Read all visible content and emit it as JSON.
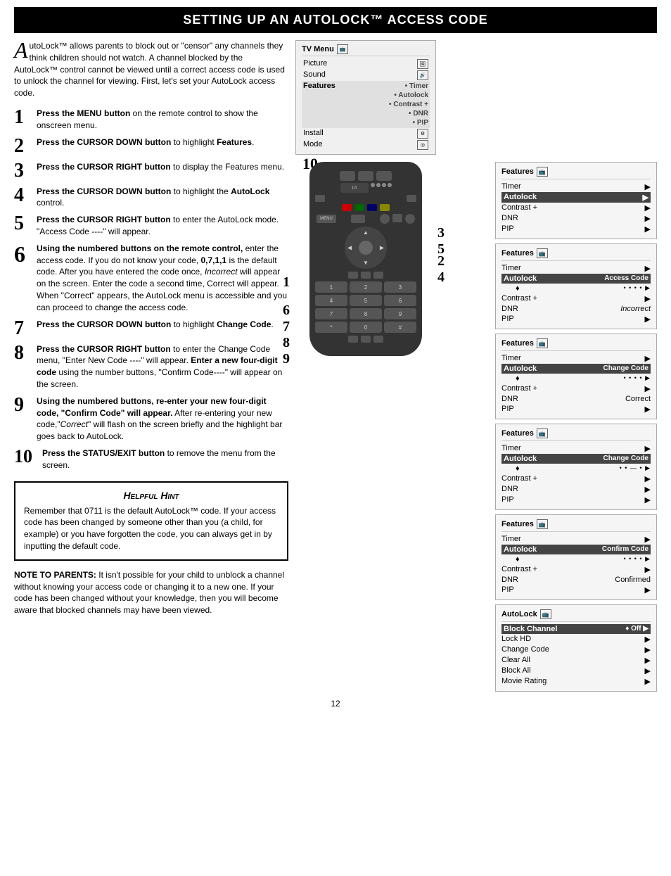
{
  "header": {
    "title": "Setting Up an AutoLock™ Access Code"
  },
  "intro": {
    "drop_cap": "A",
    "text": "utoLock™ allows parents to block out or \"censor\" any channels they think children should not watch. A channel blocked by the AutoLock™ control cannot be viewed until a correct access code is used to unlock the channel for viewing. First, let's set your AutoLock access code."
  },
  "steps": [
    {
      "num": "1",
      "text": "Press the MENU button on the remote control to show the onscreen menu."
    },
    {
      "num": "2",
      "text": "Press the CURSOR DOWN button to highlight Features."
    },
    {
      "num": "3",
      "text": "Press the CURSOR RIGHT button to display the Features menu."
    },
    {
      "num": "4",
      "text": "Press the CURSOR DOWN button to highlight the AutoLock control."
    },
    {
      "num": "5",
      "text": "Press the CURSOR RIGHT button to enter the AutoLock mode. \"Access Code ----\" will appear."
    },
    {
      "num": "6",
      "text": "Using the numbered buttons on the remote control, enter the access code. If you do not know your code, 0,7,1,1 is the default code. After you have entered the code once, Incorrect will appear on the screen. Enter the code a second time, Correct will appear. When \"Correct\" appears, the AutoLock menu is accessible and you can proceed to change the access code."
    },
    {
      "num": "7",
      "text": "Press the CURSOR DOWN button to highlight Change Code."
    },
    {
      "num": "8",
      "text": "Press the CURSOR RIGHT button to enter the Change Code menu, \"Enter New Code ----\" will appear. Enter a new four-digit code using the number buttons, \"Confirm Code----\" will appear on the screen."
    },
    {
      "num": "9",
      "text": "Using the numbered buttons, re-enter your new four-digit code, \"Confirm Code\" will appear. After re-entering your new code,\"Correct\" will flash on the screen briefly and the highlight bar goes back to AutoLock."
    },
    {
      "num": "10",
      "text": "Press the STATUS/EXIT button to remove the menu from the screen."
    }
  ],
  "hint_box": {
    "title": "Helpful Hint",
    "text": "Remember that 0711 is the default AutoLock™ code. If your access code has been changed by someone other than you (a child, for example) or you have forgotten the code, you can always get in by inputting the default code."
  },
  "note": {
    "label": "NOTE TO PARENTS:",
    "text": "It isn't possible for your child to unblock a channel without knowing your access code or changing it to a new one. If your code has been changed without your knowledge, then you will become aware that blocked channels may have been viewed."
  },
  "tv_menu": {
    "title": "TV Menu",
    "rows": [
      {
        "label": "Picture",
        "items": ""
      },
      {
        "label": "Sound",
        "items": ""
      },
      {
        "label": "Features",
        "items": "• Timer\n• Autolock\n• Contrast +\n• DNR\n• PIP",
        "bold": true
      },
      {
        "label": "Install",
        "items": ""
      },
      {
        "label": "Mode",
        "items": ""
      }
    ]
  },
  "panels": [
    {
      "title": "Features",
      "rows": [
        {
          "label": "Timer",
          "arrow": "▶",
          "value": ""
        },
        {
          "label": "Autolock",
          "arrow": "▶",
          "value": ""
        },
        {
          "label": "Contrast +",
          "arrow": "▶",
          "value": ""
        },
        {
          "label": "DNR",
          "arrow": "▶",
          "value": ""
        },
        {
          "label": "PIP",
          "arrow": "▶",
          "value": ""
        }
      ]
    },
    {
      "title": "Features",
      "subtitle": "Access Code",
      "rows": [
        {
          "label": "Timer",
          "arrow": "▶",
          "value": ""
        },
        {
          "label": "Autolock",
          "arrow": "▶",
          "value": "Access Code",
          "highlighted": true
        },
        {
          "label": "",
          "arrow": "♦",
          "value": "• • • •   ▶",
          "sub": true
        },
        {
          "label": "Contrast +",
          "arrow": "▶",
          "value": ""
        },
        {
          "label": "DNR",
          "arrow": "▶",
          "value": "Incorrect"
        },
        {
          "label": "PIP",
          "arrow": "▶",
          "value": ""
        }
      ]
    },
    {
      "title": "Features",
      "subtitle": "Change Code",
      "rows": [
        {
          "label": "Timer",
          "arrow": "▶",
          "value": ""
        },
        {
          "label": "Autolock",
          "arrow": "",
          "value": "Change Code",
          "highlighted": true
        },
        {
          "label": "",
          "arrow": "♦",
          "value": "• • • •   ▶",
          "sub": true
        },
        {
          "label": "Contrast +",
          "arrow": "▶",
          "value": ""
        },
        {
          "label": "DNR",
          "arrow": "▶",
          "value": "Correct"
        },
        {
          "label": "PIP",
          "arrow": "▶",
          "value": ""
        }
      ]
    },
    {
      "title": "Features",
      "subtitle": "Change Code 2",
      "rows": [
        {
          "label": "Timer",
          "arrow": "▶",
          "value": ""
        },
        {
          "label": "Autolock",
          "arrow": "",
          "value": "Change Code",
          "highlighted": true
        },
        {
          "label": "",
          "arrow": "♦",
          "value": "• • — •   ▶",
          "sub": true
        },
        {
          "label": "Contrast +",
          "arrow": "▶",
          "value": ""
        },
        {
          "label": "DNR",
          "arrow": "▶",
          "value": ""
        },
        {
          "label": "PIP",
          "arrow": "▶",
          "value": ""
        }
      ]
    },
    {
      "title": "Features",
      "subtitle": "Confirm Code",
      "rows": [
        {
          "label": "Timer",
          "arrow": "▶",
          "value": ""
        },
        {
          "label": "Autolock",
          "arrow": "",
          "value": "Confirm Code",
          "highlighted": true
        },
        {
          "label": "",
          "arrow": "♦",
          "value": "• • • •   ▶",
          "sub": true
        },
        {
          "label": "Contrast +",
          "arrow": "▶",
          "value": ""
        },
        {
          "label": "DNR",
          "arrow": "▶",
          "value": "Confirmed"
        },
        {
          "label": "PIP",
          "arrow": "▶",
          "value": ""
        }
      ]
    },
    {
      "title": "AutoLock",
      "rows": [
        {
          "label": "Block Channel",
          "arrow": "♦",
          "value": "Off   ▶",
          "highlighted": true
        },
        {
          "label": "Lock HD",
          "arrow": "▶",
          "value": ""
        },
        {
          "label": "Change Code",
          "arrow": "▶",
          "value": ""
        },
        {
          "label": "Clear All",
          "arrow": "▶",
          "value": ""
        },
        {
          "label": "Block All",
          "arrow": "▶",
          "value": ""
        },
        {
          "label": "Movie Rating",
          "arrow": "▶",
          "value": ""
        }
      ]
    }
  ],
  "page_number": "12",
  "remote": {
    "step_labels": [
      "1",
      "2",
      "3",
      "4",
      "5",
      "6",
      "7",
      "8",
      "9",
      "10"
    ]
  }
}
